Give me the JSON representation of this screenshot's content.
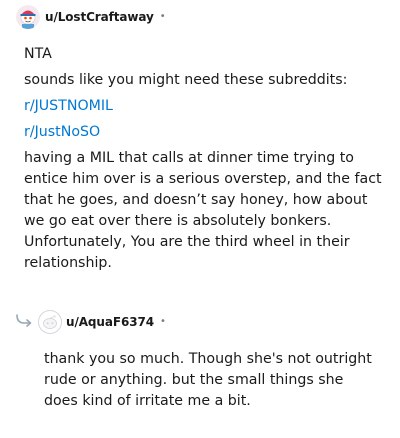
{
  "comment1": {
    "username": "u/LostCraftaway",
    "separator": "•",
    "avatar_icon": "reddit-snoo-avatar-icon",
    "lines": {
      "verdict": "NTA",
      "intro": "sounds like you might need these subreddits:",
      "link1": "r/JUSTNOMIL",
      "link2": "r/JustNoSO",
      "paragraph": "having a MIL that calls at dinner time trying to entice him over is a serious overstep, and the fact that he goes, and doesn’t say honey, how about we go eat over there is absolutely bonkers. Unfortunately, You are the third wheel in their relationship."
    },
    "link_color": "#0079d3"
  },
  "comment2": {
    "username": "u/AquaF6374",
    "separator": "•",
    "avatar_icon": "default-avatar-icon",
    "reply_icon": "reply-arrow-icon",
    "text": "thank you so much. Though she's not outright rude or anything. but the small things she does kind of irritate me a bit."
  }
}
